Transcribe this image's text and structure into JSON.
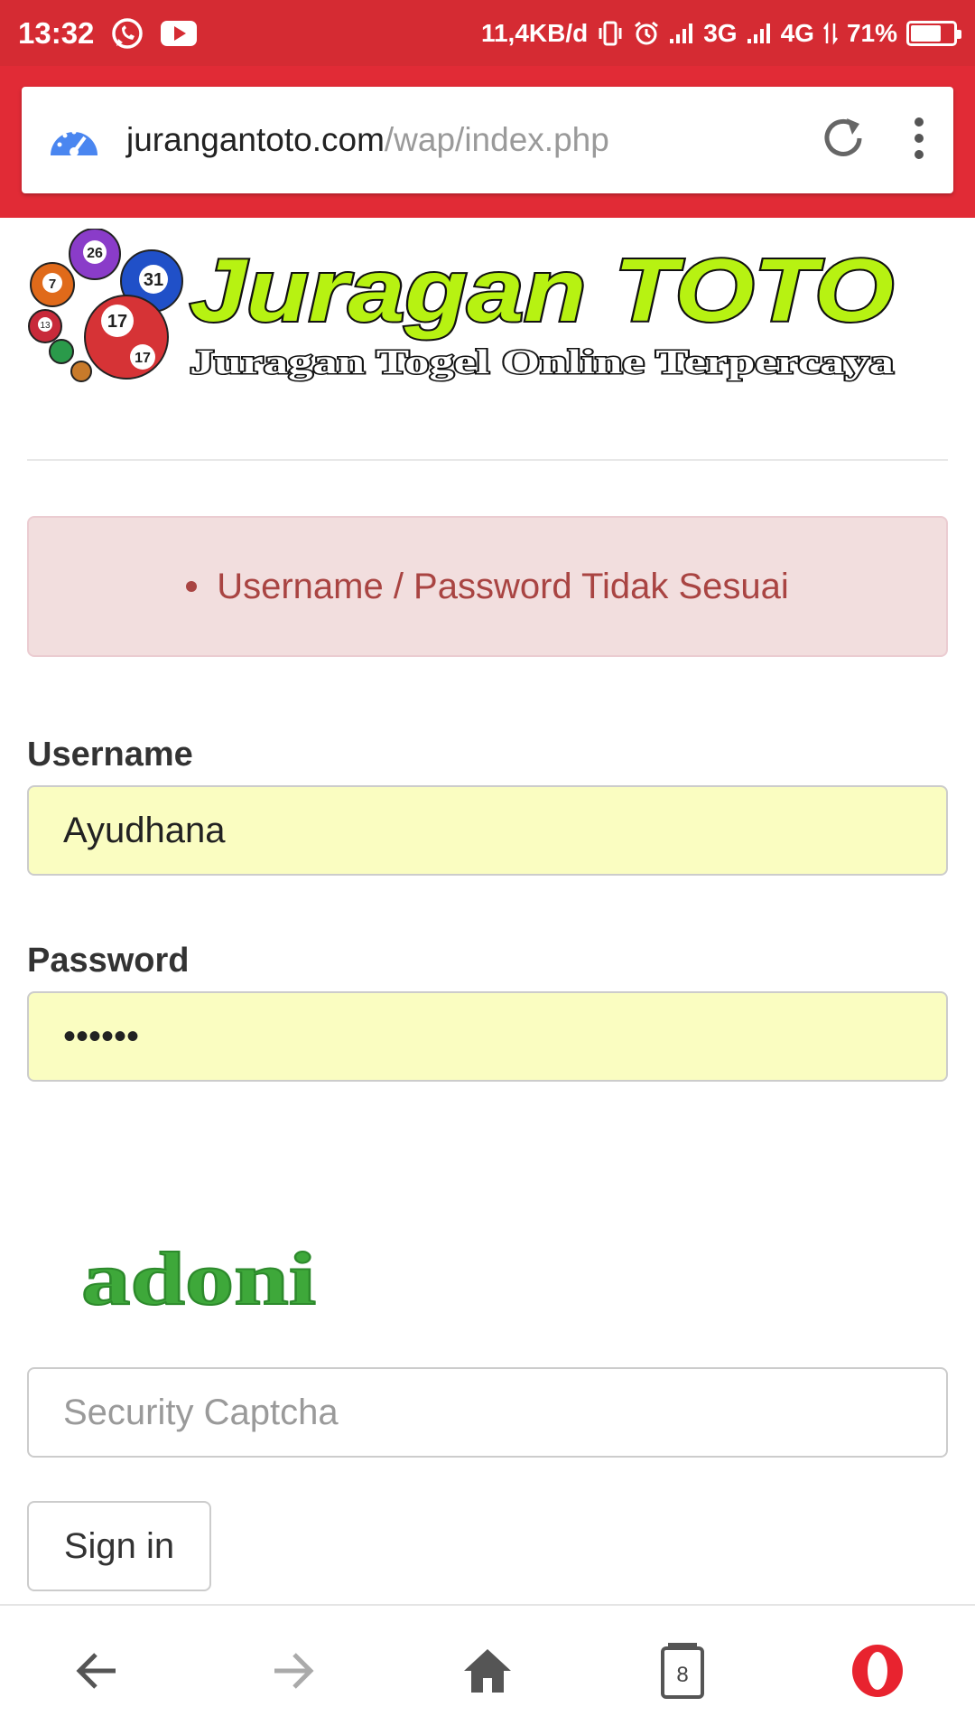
{
  "status_bar": {
    "time": "13:32",
    "network_speed": "11,4KB/d",
    "network_1": "3G",
    "network_2": "4G",
    "battery": "71%",
    "battery_level": 0.71,
    "icons": [
      "whatsapp-icon",
      "youtube-icon",
      "vibrate-icon",
      "alarm-icon",
      "signal-icon",
      "battery-icon"
    ]
  },
  "browser": {
    "domain": "jurangantoto.com",
    "path": "/wap/index.php",
    "icons": [
      "speedometer-icon",
      "reload-icon",
      "menu-icon"
    ]
  },
  "header": {
    "logo_title": "Juragan TOTO",
    "logo_subtitle": "Juragan Togel Online Terpercaya",
    "balls": [
      "26",
      "31",
      "7",
      "17",
      "17",
      "13"
    ]
  },
  "alert": {
    "message": "Username / Password Tidak Sesuai"
  },
  "form": {
    "username_label": "Username",
    "username_value": "Ayudhana",
    "password_label": "Password",
    "password_value": "••••••",
    "captcha_image_text": "adoni",
    "captcha_placeholder": "Security Captcha",
    "signin_label": "Sign in"
  },
  "navbar": {
    "tabs_count": "8",
    "icons": [
      "back-icon",
      "forward-icon",
      "home-icon",
      "tabs-icon",
      "opera-icon"
    ]
  },
  "colors": {
    "status_bar": "#d52b33",
    "browser_bar": "#e12b36",
    "alert_bg": "#f2dede",
    "alert_text": "#a94442",
    "autofill_bg": "#fafdc1",
    "logo_green": "#b7f212"
  }
}
